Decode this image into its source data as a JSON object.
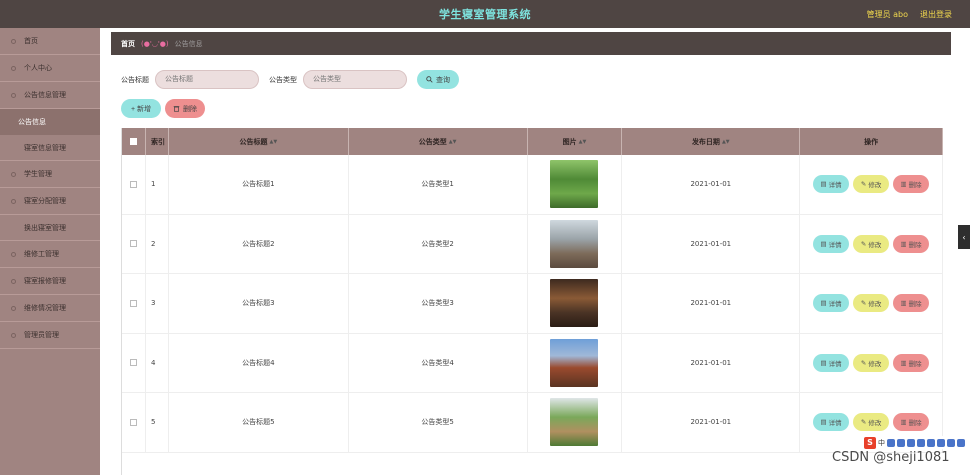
{
  "header": {
    "title": "学生寝室管理系统",
    "user": "管理员 abo",
    "logout": "退出登录"
  },
  "sidebar": {
    "items": [
      {
        "label": "首页"
      },
      {
        "label": "个人中心"
      },
      {
        "label": "公告信息管理"
      }
    ],
    "sub_active": "公告信息",
    "sub_plain": "寝室信息管理",
    "items2": [
      {
        "label": "学生管理"
      },
      {
        "label": "寝室分配管理"
      }
    ],
    "sub_plain2": "换出寝室管理",
    "items3": [
      {
        "label": "维修工管理"
      },
      {
        "label": "寝室报修管理"
      },
      {
        "label": "维修情况管理"
      },
      {
        "label": "管理员管理"
      }
    ]
  },
  "breadcrumb": {
    "home": "首页",
    "sep": "(●'◡'●)",
    "current": "公告信息"
  },
  "search": {
    "title_label": "公告标题",
    "title_placeholder": "公告标题",
    "type_label": "公告类型",
    "type_placeholder": "公告类型",
    "query_button": "查询"
  },
  "toolbar": {
    "add": "+ 新增",
    "delete": "删除"
  },
  "table": {
    "headers": {
      "index": "索引",
      "title": "公告标题",
      "type": "公告类型",
      "image": "图片",
      "date": "发布日期",
      "ops": "操作"
    },
    "rows": [
      {
        "index": "1",
        "title": "公告标题1",
        "type": "公告类型1",
        "date": "2021-01-01"
      },
      {
        "index": "2",
        "title": "公告标题2",
        "type": "公告类型2",
        "date": "2021-01-01"
      },
      {
        "index": "3",
        "title": "公告标题3",
        "type": "公告类型3",
        "date": "2021-01-01"
      },
      {
        "index": "4",
        "title": "公告标题4",
        "type": "公告类型4",
        "date": "2021-01-01"
      },
      {
        "index": "5",
        "title": "公告标题5",
        "type": "公告类型5",
        "date": "2021-01-01"
      }
    ],
    "ops": {
      "detail": "详情",
      "edit": "修改",
      "delete": "删除"
    }
  },
  "tray": {
    "text": "中"
  },
  "watermark": "CSDN @sheji1081",
  "colors": {
    "topbar": "#4f4543",
    "title": "#7ee4df",
    "sidebar": "#a08481",
    "teal": "#93e3e0",
    "yellow": "#eaea82",
    "red": "#ee8f8f"
  }
}
